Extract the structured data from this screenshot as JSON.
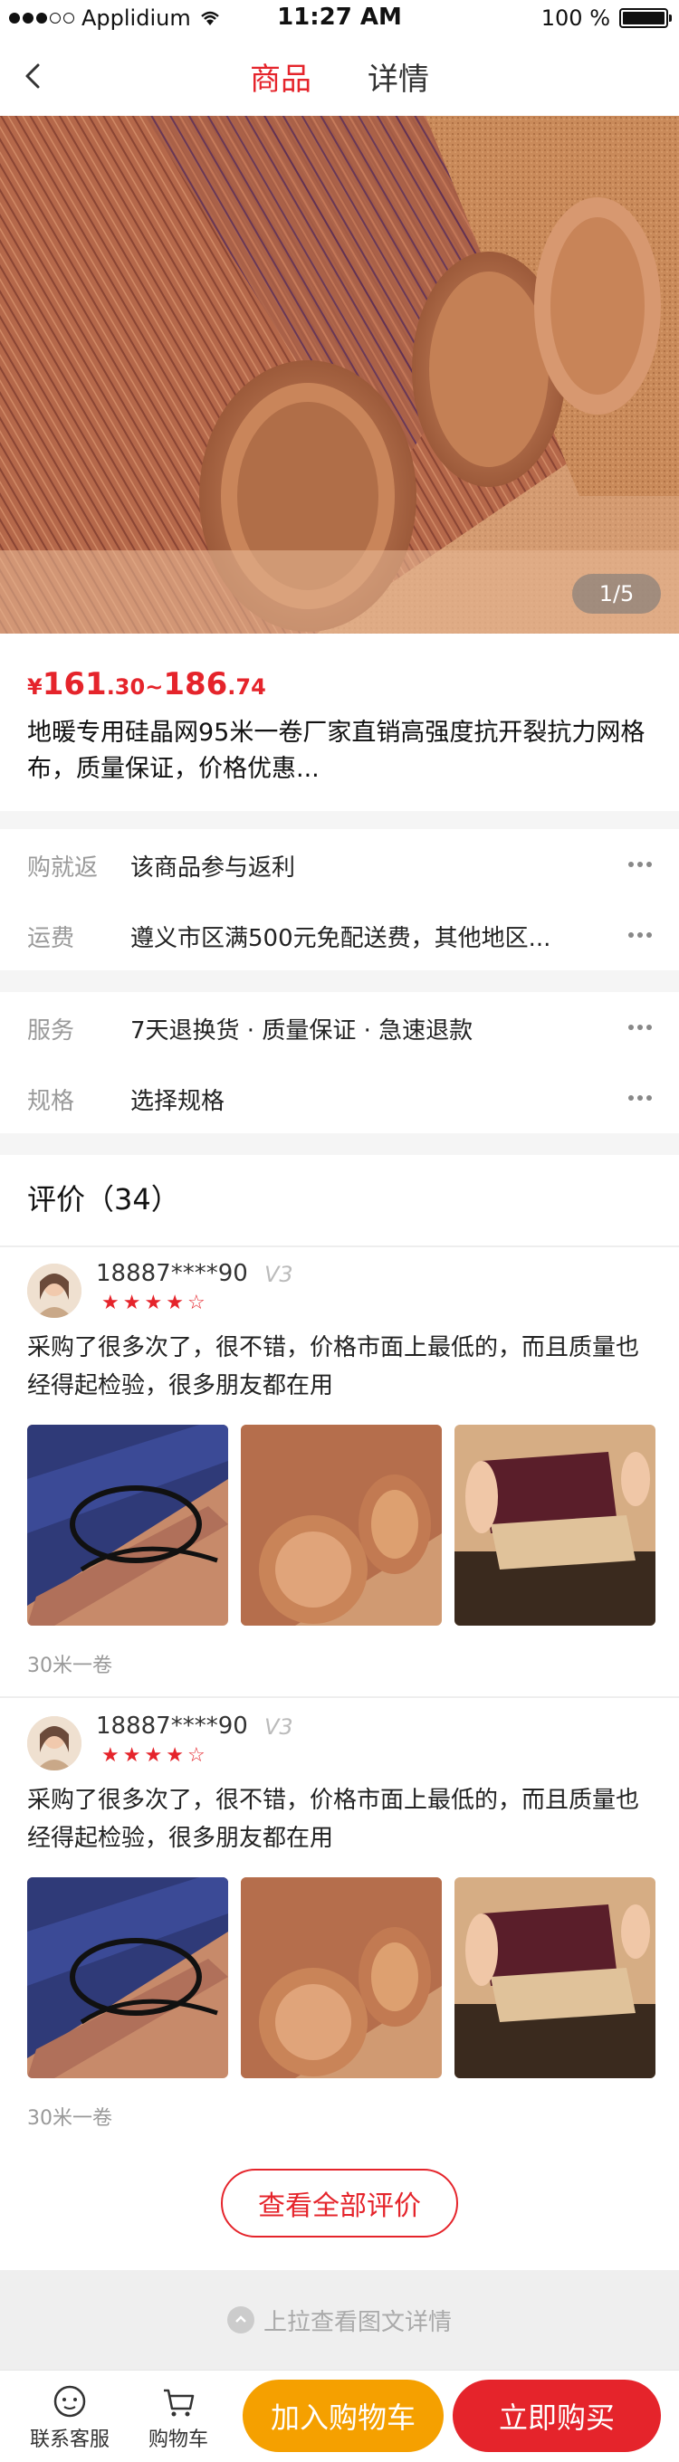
{
  "status_bar": {
    "carrier": "Applidium",
    "time": "11:27 AM",
    "battery": "100 %"
  },
  "nav": {
    "tabs": [
      {
        "label": "商品",
        "active": true
      },
      {
        "label": "详情",
        "active": false
      }
    ]
  },
  "gallery": {
    "pager": "1/5"
  },
  "product": {
    "price_symbol": "¥",
    "price_low_int": "161",
    "price_low_dec": ".30",
    "price_sep": "~",
    "price_high_int": "186",
    "price_high_dec": ".74",
    "title": "地暖专用硅晶网95米一卷厂家直销高强度抗开裂抗力网格布，质量保证，价格优惠..."
  },
  "info": {
    "group1": [
      {
        "label": "购就返",
        "value": "该商品参与返利"
      },
      {
        "label": "运费",
        "value": "遵义市区满500元免配送费，其他地区..."
      }
    ],
    "group2": [
      {
        "label": "服务",
        "value": "7天退换货 · 质量保证 · 急速退款"
      },
      {
        "label": "规格",
        "value": "选择规格"
      }
    ]
  },
  "reviews": {
    "header": "评价（34）",
    "items": [
      {
        "user": "18887****90",
        "level": "V3",
        "rating": 4,
        "text": "采购了很多次了，很不错，价格市面上最低的，而且质量也经得起检验，很多朋友都在用",
        "spec": "30米一卷"
      },
      {
        "user": "18887****90",
        "level": "V3",
        "rating": 4,
        "text": "采购了很多次了，很不错，价格市面上最低的，而且质量也经得起检验，很多朋友都在用",
        "spec": "30米一卷"
      }
    ],
    "all_button": "查看全部评价"
  },
  "pull_up": "上拉查看图文详情",
  "bottom_bar": {
    "service": "联系客服",
    "cart": "购物车",
    "add_to_cart": "加入购物车",
    "buy_now": "立即购买"
  },
  "colors": {
    "accent": "#e5242b",
    "cart_button": "#f5a000"
  }
}
